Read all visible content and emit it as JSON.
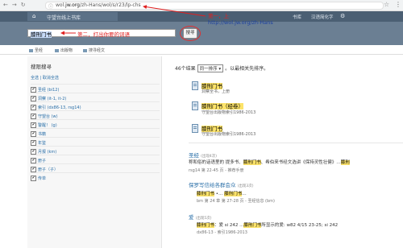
{
  "browser": {
    "url_prefix": "wol.",
    "url_domain": "jw.org",
    "url_path": "/zh-Hans/wol/s/r23/lp-chs"
  },
  "topbar": {
    "home_glyph": "⌂",
    "title": "守望台线上书库",
    "library_link": "书库",
    "language": "汉语简化字"
  },
  "search": {
    "query": "膝刑门书",
    "button_label": "搜寻"
  },
  "tabs": [
    {
      "label": "圣经"
    },
    {
      "label": "出版物"
    },
    {
      "label": "搜寻经文"
    }
  ],
  "sidebar": {
    "title": "搜限搜寻",
    "select_links": "全选 | 取消全选",
    "items": [
      {
        "label": "圣经 (bi12)",
        "checked": true
      },
      {
        "label": "洞察 (it-1, it-2)",
        "checked": true
      },
      {
        "label": "索引 (dx86-13, rsg14)",
        "checked": true
      },
      {
        "label": "守望台 (w)",
        "checked": true
      },
      {
        "label": "警醒！ (g)",
        "checked": true
      },
      {
        "label": "书籍",
        "checked": true
      },
      {
        "label": "年鉴",
        "checked": true
      },
      {
        "label": "月报 (km)",
        "checked": true
      },
      {
        "label": "册子",
        "checked": true
      },
      {
        "label": "册子（子）",
        "checked": true
      },
      {
        "label": "传单",
        "checked": true
      }
    ]
  },
  "results": {
    "count_text": "46个结果",
    "sort_value": "同一排序",
    "sort_suffix": "。以最相关先排序。",
    "publications": [
      {
        "title": "膝刑门书",
        "source": "洞察全书，上册"
      },
      {
        "title": "膝刑门书（经卷）",
        "source": "守望台出版物索引1986-2013"
      },
      {
        "title": "膝刑门书",
        "source": "守望台出版物索引1986-2013"
      }
    ],
    "articles": [
      {
        "title": "圣经",
        "hits": "(出现4次)",
        "snippet_pre": "称和俗的话语里的 提多书、",
        "snippet_hl": "膝刑门书",
        "snippet_post": "、希伯来书经文选讲《保持灵性壮健》…",
        "snippet_tail": "膝刑",
        "source": "rsg14 第 22-45 页 - 推荐手册"
      },
      {
        "title": "保罗写信给各群会众",
        "hits": "(出现3次)",
        "line_a": "膝刑门书",
        "line_sep": "•…",
        "line_b": "膝刑门书",
        "line_end": "…",
        "source": "bm 第 24 章 第 27-28 页 - 圣经信息 (bm)"
      },
      {
        "title": "爱",
        "hits": "(出现5次)",
        "snippet_hl": "膝刑门书",
        "snippet_mid": "：爱 si 242 ...",
        "snippet_hl2": "膝刑门书",
        "snippet_post": "所显示的爱: w82 4/15 23-25; si 242",
        "source": "dx86-13 - 索引1986-2013"
      }
    ]
  },
  "annotations": {
    "step1": "第一，上",
    "step1_url": "http://wol.jw.org/zh-Hans",
    "step2": "第二，打出你要的词语"
  },
  "colors": {
    "topbar": "#4b5f73",
    "searchbar": "#6b7f93",
    "link": "#2a6fa8",
    "highlight": "#fce36a",
    "annotation": "#e02020"
  }
}
